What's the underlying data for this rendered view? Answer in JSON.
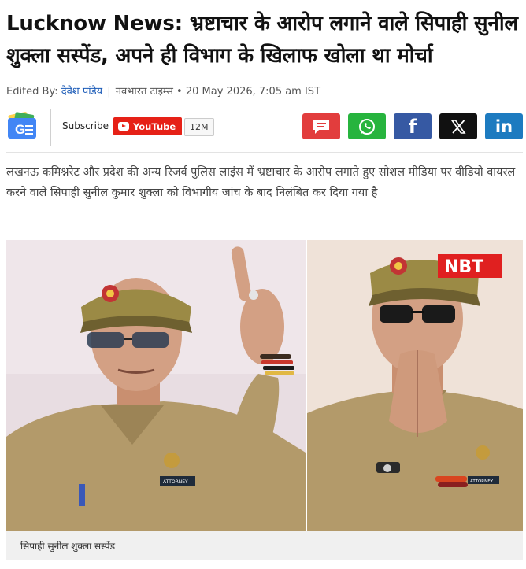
{
  "article": {
    "headline": "Lucknow News: भ्रष्टाचार के आरोप लगाने वाले सिपाही सुनील शुक्ला सस्पेंड, अपने ही विभाग के खिलाफ खोला था मोर्चा",
    "meta": {
      "edited_by_label": "Edited By:",
      "editor": "देवेश पांडेय",
      "publication": "नवभारत टाइम्स",
      "timestamp": "20 May 2026, 7:05 am IST"
    },
    "summary": "लखनऊ कमिश्नरेट और प्रदेश की अन्य रिजर्व पुलिस लाइंस में भ्रष्टाचार के आरोप लगाते हुए सोशल मीडिया पर वीडियो वायरल करने वाले सिपाही सुनील कुमार शुक्ला को विभागीय जांच के बाद निलंबित कर दिया गया है",
    "image": {
      "watermark": "NBT",
      "badge_text": "ATTORNEY",
      "caption": "सिपाही सुनील शुक्ला सस्पेंड"
    }
  },
  "share_bar": {
    "google_news_icon": "google-news-icon",
    "subscribe_label": "Subscribe",
    "youtube_label": "YouTube",
    "youtube_count": "12M",
    "buttons": [
      {
        "name": "comments",
        "icon": "chat-bubble-icon",
        "color": "#e23d3d"
      },
      {
        "name": "whatsapp",
        "icon": "whatsapp-icon",
        "color": "#27b43e"
      },
      {
        "name": "facebook",
        "icon": "facebook-icon",
        "color": "#3659a3"
      },
      {
        "name": "x",
        "icon": "x-icon",
        "color": "#111111"
      },
      {
        "name": "linkedin",
        "icon": "linkedin-icon",
        "color": "#1d7bc0"
      }
    ]
  }
}
